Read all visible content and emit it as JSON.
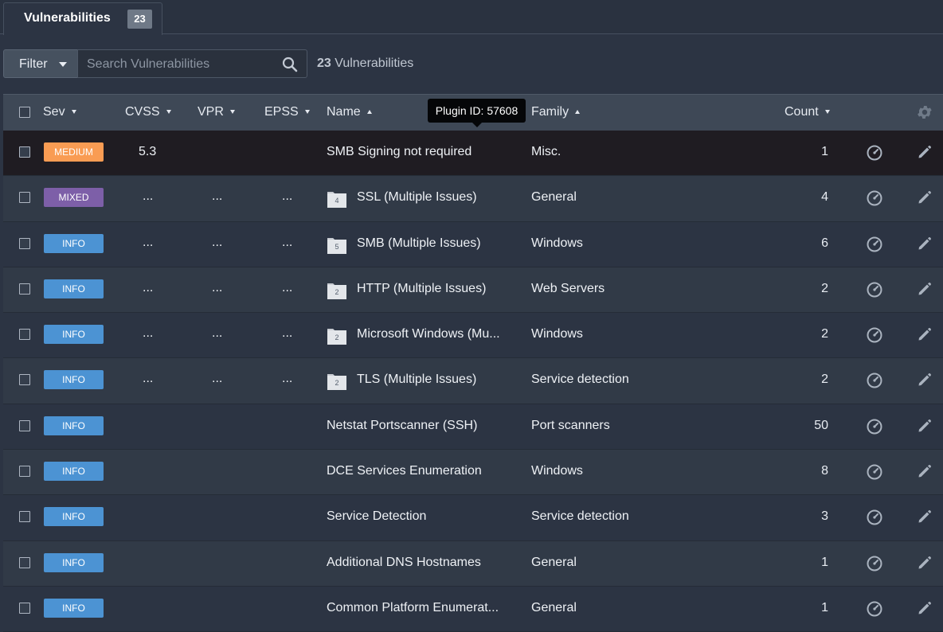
{
  "tab": {
    "label": "Vulnerabilities",
    "count": "23"
  },
  "toolbar": {
    "filter_label": "Filter",
    "search_placeholder": "Search Vulnerabilities",
    "count_number": "23",
    "count_label": " Vulnerabilities"
  },
  "columns": {
    "sev": "Sev",
    "cvss": "CVSS",
    "vpr": "VPR",
    "epss": "EPSS",
    "name": "Name",
    "family": "Family",
    "count": "Count"
  },
  "tooltip": "Plugin ID: 57608",
  "colors": {
    "medium": "#f99c53",
    "mixed": "#7d5fa8",
    "info": "#4c93d3"
  },
  "rows": [
    {
      "severity": "MEDIUM",
      "sev_color": "medium",
      "cvss": "5.3",
      "vpr": "",
      "epss": "",
      "folder": "",
      "name": "SMB Signing not required",
      "family": "Misc.",
      "count": "1"
    },
    {
      "severity": "MIXED",
      "sev_color": "mixed",
      "cvss": "...",
      "vpr": "...",
      "epss": "...",
      "folder": "4",
      "name": "SSL (Multiple Issues)",
      "family": "General",
      "count": "4"
    },
    {
      "severity": "INFO",
      "sev_color": "info",
      "cvss": "...",
      "vpr": "...",
      "epss": "...",
      "folder": "5",
      "name": "SMB (Multiple Issues)",
      "family": "Windows",
      "count": "6"
    },
    {
      "severity": "INFO",
      "sev_color": "info",
      "cvss": "...",
      "vpr": "...",
      "epss": "...",
      "folder": "2",
      "name": "HTTP (Multiple Issues)",
      "family": "Web Servers",
      "count": "2"
    },
    {
      "severity": "INFO",
      "sev_color": "info",
      "cvss": "...",
      "vpr": "...",
      "epss": "...",
      "folder": "2",
      "name": "Microsoft Windows (Mu...",
      "family": "Windows",
      "count": "2"
    },
    {
      "severity": "INFO",
      "sev_color": "info",
      "cvss": "...",
      "vpr": "...",
      "epss": "...",
      "folder": "2",
      "name": "TLS (Multiple Issues)",
      "family": "Service detection",
      "count": "2"
    },
    {
      "severity": "INFO",
      "sev_color": "info",
      "cvss": "",
      "vpr": "",
      "epss": "",
      "folder": "",
      "name": "Netstat Portscanner (SSH)",
      "family": "Port scanners",
      "count": "50"
    },
    {
      "severity": "INFO",
      "sev_color": "info",
      "cvss": "",
      "vpr": "",
      "epss": "",
      "folder": "",
      "name": "DCE Services Enumeration",
      "family": "Windows",
      "count": "8"
    },
    {
      "severity": "INFO",
      "sev_color": "info",
      "cvss": "",
      "vpr": "",
      "epss": "",
      "folder": "",
      "name": "Service Detection",
      "family": "Service detection",
      "count": "3"
    },
    {
      "severity": "INFO",
      "sev_color": "info",
      "cvss": "",
      "vpr": "",
      "epss": "",
      "folder": "",
      "name": "Additional DNS Hostnames",
      "family": "General",
      "count": "1"
    },
    {
      "severity": "INFO",
      "sev_color": "info",
      "cvss": "",
      "vpr": "",
      "epss": "",
      "folder": "",
      "name": "Common Platform Enumerat...",
      "family": "General",
      "count": "1"
    }
  ]
}
